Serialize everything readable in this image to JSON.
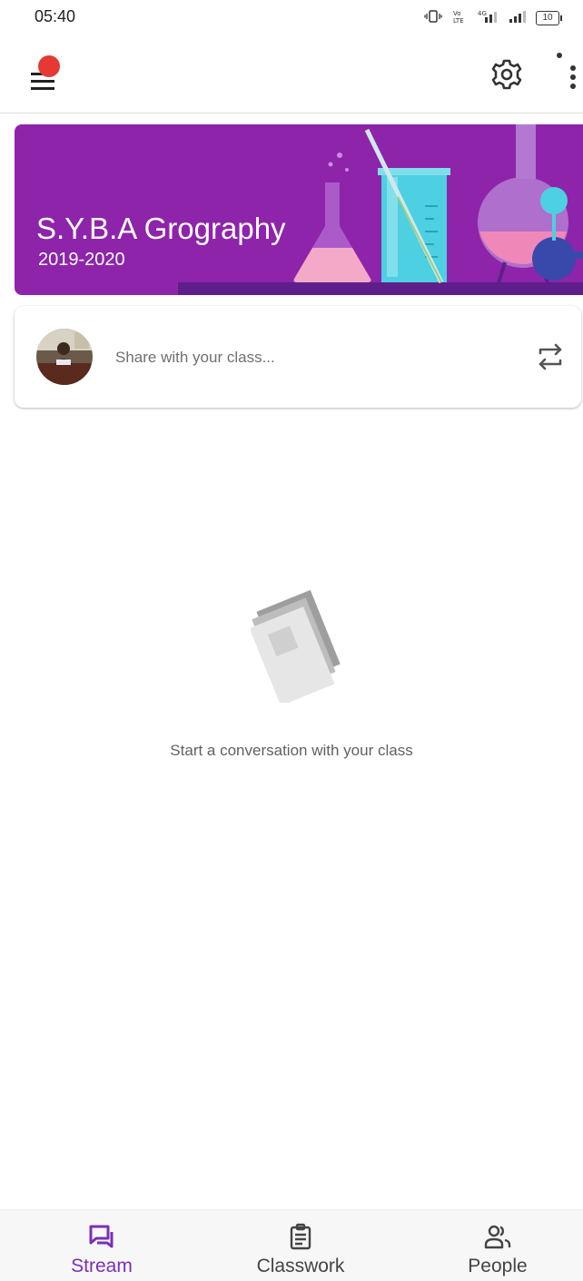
{
  "status_bar": {
    "time": "05:40",
    "battery": "10",
    "icons": [
      "vibrate-icon",
      "volte-icon",
      "4g-signal-icon",
      "signal-icon",
      "battery-icon"
    ]
  },
  "app_bar": {
    "icons": [
      "menu-icon",
      "gear-icon",
      "more-vert-icon"
    ],
    "notification_color": "#e53935"
  },
  "class_banner": {
    "title": "S.Y.B.A Grography",
    "subtitle": "2019-2020",
    "background_color": "#8e24aa"
  },
  "share": {
    "placeholder": "Share with your class...",
    "icon": "repost-icon"
  },
  "empty_state": {
    "message": "Start a conversation with your class",
    "icon": "stream-posts-illustration"
  },
  "bottom_nav": {
    "accent_color": "#7b2fb5",
    "items": [
      {
        "label": "Stream",
        "icon": "stream-icon",
        "active": true
      },
      {
        "label": "Classwork",
        "icon": "classwork-icon",
        "active": false
      },
      {
        "label": "People",
        "icon": "people-icon",
        "active": false
      }
    ]
  }
}
